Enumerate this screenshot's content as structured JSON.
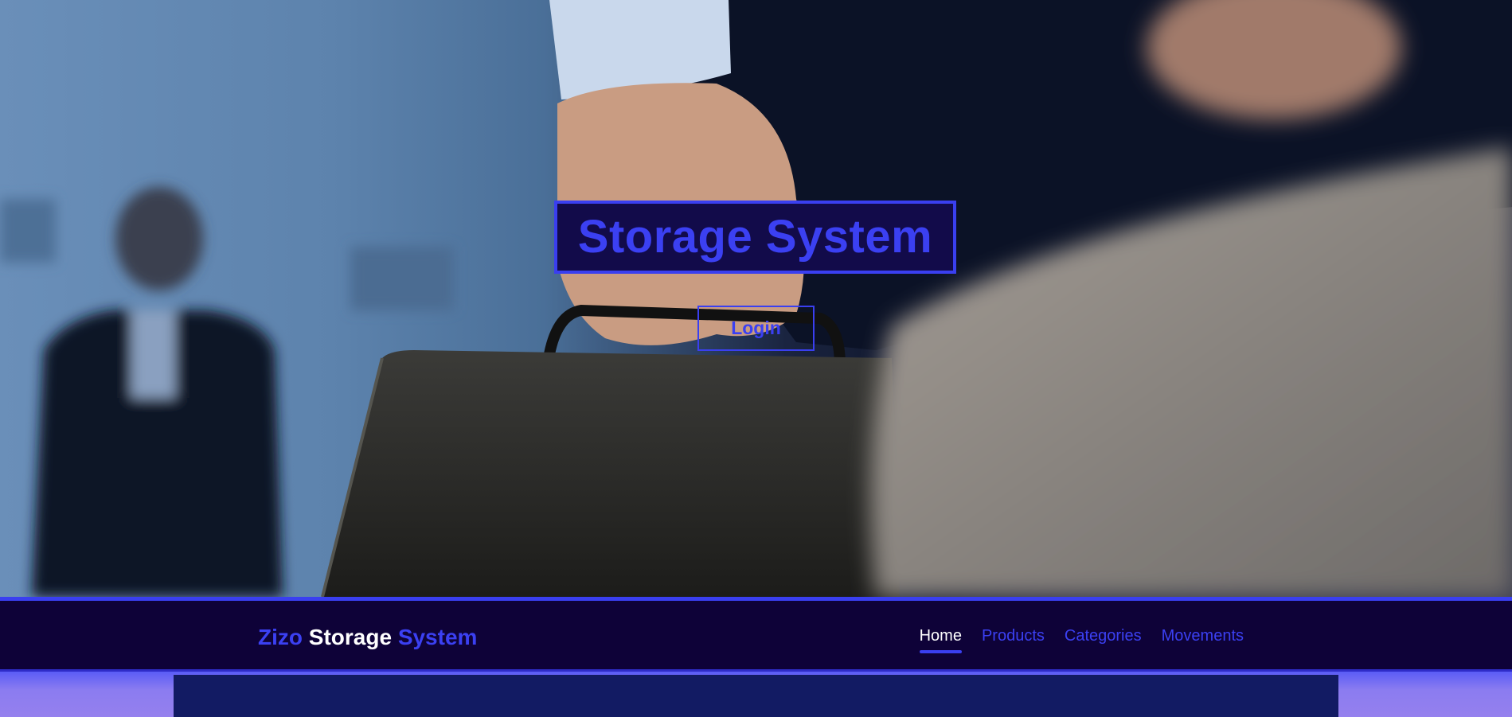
{
  "hero": {
    "title": "Storage System",
    "login_label": "Login"
  },
  "navbar": {
    "brand": {
      "part1": "Zizo",
      "part2": "Storage",
      "part3": "System"
    },
    "links": [
      {
        "label": "Home",
        "active": true
      },
      {
        "label": "Products",
        "active": false
      },
      {
        "label": "Categories",
        "active": false
      },
      {
        "label": "Movements",
        "active": false
      }
    ]
  },
  "colors": {
    "accent": "#3b40f2",
    "navbar_bg": "#0e0238",
    "panel_bg": "#121b63",
    "below_bg": "#8f7ef0"
  }
}
